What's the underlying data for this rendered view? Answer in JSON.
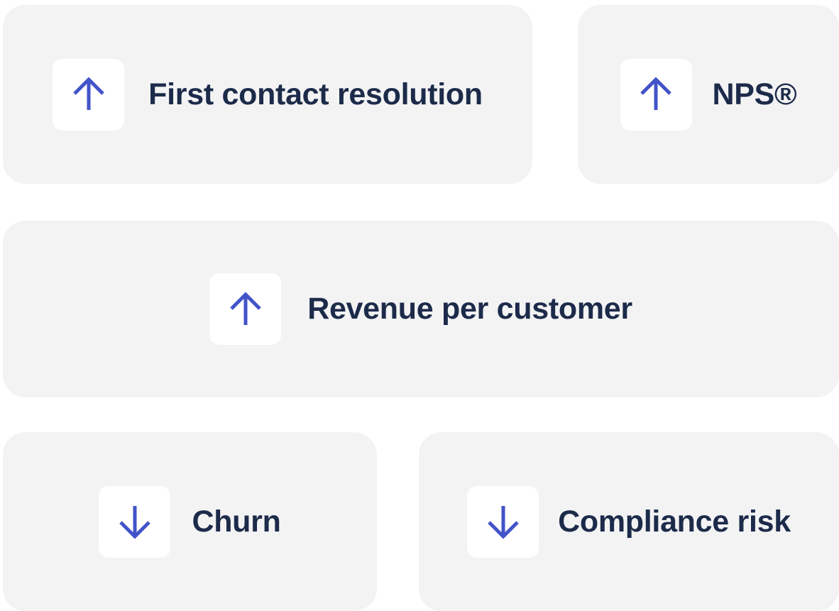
{
  "accent_color": "#4253c9",
  "text_color": "#1d2b4a",
  "card_color": "#f3f3f4",
  "metrics": [
    {
      "label": "First contact resolution",
      "direction": "up",
      "icon": "arrow-up-icon"
    },
    {
      "label": "NPS®",
      "direction": "up",
      "icon": "arrow-up-icon"
    },
    {
      "label": "Revenue per customer",
      "direction": "up",
      "icon": "arrow-up-icon"
    },
    {
      "label": "Churn",
      "direction": "down",
      "icon": "arrow-down-icon"
    },
    {
      "label": "Compliance risk",
      "direction": "down",
      "icon": "arrow-down-icon"
    }
  ]
}
